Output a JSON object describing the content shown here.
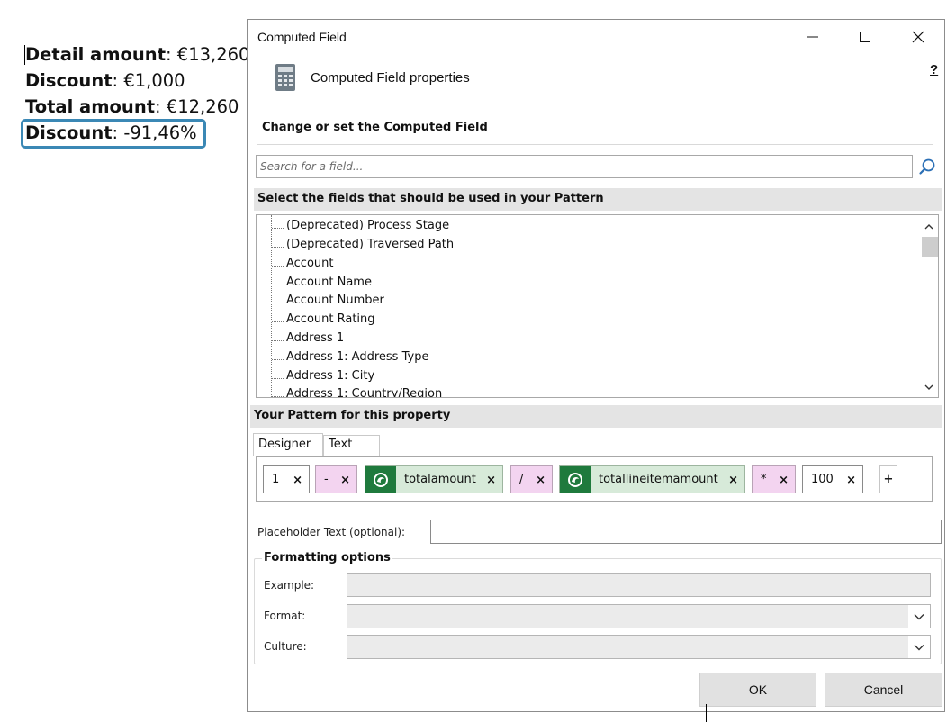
{
  "document": {
    "lines": [
      {
        "label": "Detail amount",
        "value": "€13,260"
      },
      {
        "label": "Discount",
        "value": "€1,000"
      },
      {
        "label": "Total amount",
        "value": "€12,260"
      },
      {
        "label": "Discount",
        "value": "-91,46%"
      }
    ],
    "separator": ": "
  },
  "dialog": {
    "title": "Computed Field",
    "header": "Computed Field properties",
    "help": "?",
    "section_label": "Change or set the Computed Field",
    "search_placeholder": "Search for a field...",
    "fields_bar": "Select the fields that should be used in your Pattern",
    "fields": [
      "(Deprecated) Process Stage",
      "(Deprecated) Traversed Path",
      "Account",
      "Account Name",
      "Account Number",
      "Account Rating",
      "Address 1",
      "Address 1: Address Type",
      "Address 1: City",
      "Address 1: Country/Region"
    ],
    "pattern_bar": "Your Pattern for this property",
    "tabs": {
      "designer": "Designer",
      "text": "Text"
    },
    "tokens": [
      "1",
      "-",
      "totalamount",
      "/",
      "totallineitemamount",
      "*",
      "100"
    ],
    "token_remove": "×",
    "add": "+",
    "placeholder_label": "Placeholder Text (optional):",
    "placeholder_value": "",
    "formatting": {
      "legend": "Formatting options",
      "example_label": "Example:",
      "format_label": "Format:",
      "culture_label": "Culture:"
    },
    "buttons": {
      "ok": "OK",
      "cancel": "Cancel"
    }
  },
  "colors": {
    "field_token_icon": "#1f7a3d",
    "operator_token": "#f3d4f0",
    "field_token": "#d7ead9",
    "highlight": "#3b88b5"
  }
}
